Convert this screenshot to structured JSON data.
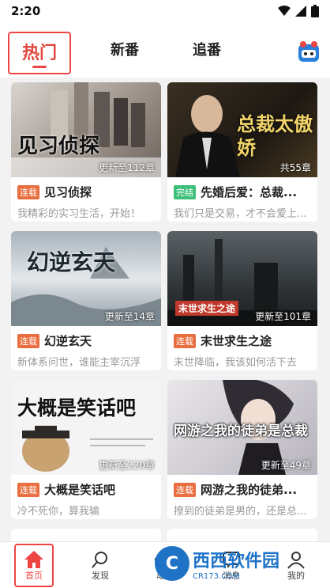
{
  "status": {
    "time": "2:20"
  },
  "tabs": [
    {
      "label": "热门"
    },
    {
      "label": "新番"
    },
    {
      "label": "追番"
    }
  ],
  "cards": [
    {
      "cover_title": "见习侦探",
      "progress": "更新至112章",
      "status": "连载",
      "name": "见习侦探",
      "desc": "我精彩的实习生活，开始！"
    },
    {
      "cover_title": "总裁太傲娇",
      "progress": "共55章",
      "status": "完结",
      "name": "先婚后爱：总裁...",
      "desc": "我们只是交易，才不会爱上..."
    },
    {
      "cover_title": "幻逆玄天",
      "progress": "更新至14章",
      "status": "连载",
      "name": "幻逆玄天",
      "desc": "新体系问世，谁能主宰沉浮"
    },
    {
      "cover_title": "末世求生之途",
      "progress": "更新至101章",
      "status": "连载",
      "name": "末世求生之途",
      "desc": "末世降临，我该如何活下去"
    },
    {
      "cover_title": "大概是笑话吧",
      "progress": "更新至220章",
      "status": "连载",
      "name": "大概是笑话吧",
      "desc": "冷不死你，算我输"
    },
    {
      "cover_title": "网游之我的徒弟是总裁",
      "progress": "更新至49章",
      "status": "连载",
      "name": "网游之我的徒弟...",
      "desc": "撩到的徒弟是男的，还是总..."
    }
  ],
  "bottom_nav": [
    {
      "label": "首页"
    },
    {
      "label": "发现"
    },
    {
      "label": "动态"
    },
    {
      "label": "消息"
    },
    {
      "label": "我的"
    }
  ],
  "watermark": {
    "main": "西西软件园",
    "sub": "CR173.COM"
  },
  "colors": {
    "accent": "#e0483f",
    "ongoing": "#e96e3f",
    "done": "#3dbf7a"
  }
}
